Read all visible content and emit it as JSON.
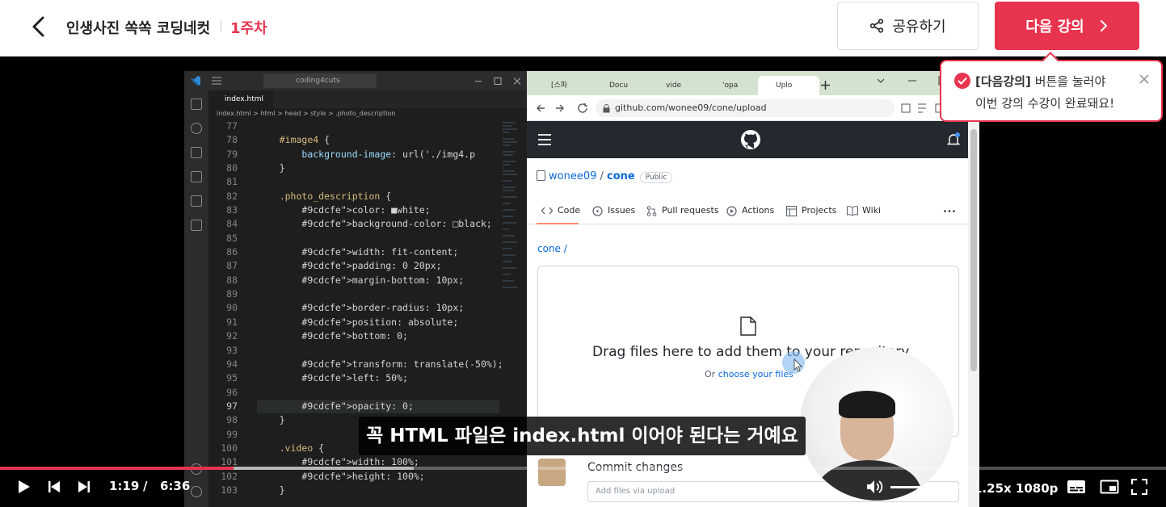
{
  "header": {
    "course_title": "인생사진 쏙쏙 코딩네컷",
    "week": "1주차",
    "share_label": "공유하기",
    "next_label": "다음 강의",
    "accent": "#e8344e"
  },
  "tooltip": {
    "highlight": "[다음강의]",
    "line1_rest": " 버튼을 눌러야",
    "line2": "이번 강의 수강이 완료돼요!"
  },
  "vscode": {
    "search": "coding4cuts",
    "tab": "index.html",
    "breadcrumb": "index.html  >  html  >  head  >  style  >  .photo_description",
    "line_numbers": [
      "77",
      "78",
      "79",
      "80",
      "81",
      "82",
      "83",
      "84",
      "85",
      "86",
      "87",
      "88",
      "89",
      "90",
      "91",
      "92",
      "93",
      "94",
      "95",
      "96",
      "97",
      "98",
      "99",
      "100",
      "101",
      "102",
      "103"
    ],
    "code": [
      "",
      "    #image4 {",
      "        background-image: url('./img4.p",
      "    }",
      "",
      "    .photo_description {",
      "        color: ■white;",
      "        background-color: □black;",
      "",
      "        width: fit-content;",
      "        padding: 0 20px;",
      "        margin-bottom: 10px;",
      "",
      "        border-radius: 10px;",
      "        position: absolute;",
      "        bottom: 0;",
      "",
      "        transform: translate(-50%);",
      "        left: 50%;",
      "",
      "        opacity: 0;",
      "    }",
      "",
      "    .video {",
      "        width: 100%;",
      "        height: 100%;",
      "    }"
    ]
  },
  "browser": {
    "tabs": [
      "[스파",
      "Docu",
      "vide",
      "'opa",
      "Uplo"
    ],
    "url": "github.com/wonee09/cone/upload",
    "repo_owner": "wonee09",
    "repo_name": "cone",
    "visibility": "Public",
    "nav": [
      "Code",
      "Issues",
      "Pull requests",
      "Actions",
      "Projects",
      "Wiki"
    ],
    "path": "cone /",
    "drop_title": "Drag files here to add them to your repository",
    "drop_sub_prefix": "Or ",
    "drop_sub_link": "choose your files",
    "commit_title": "Commit changes",
    "commit_placeholder": "Add files via upload"
  },
  "subtitle": "꼭 HTML 파일은 index.html 이어야 된다는 거예요",
  "player": {
    "current_time": "1:19",
    "separator": "/",
    "duration": "6:36",
    "progress_fraction": 0.2,
    "buffered_fraction": 0.355,
    "volume_fraction": 1.0,
    "speed_quality": "1.25x 1080p"
  }
}
